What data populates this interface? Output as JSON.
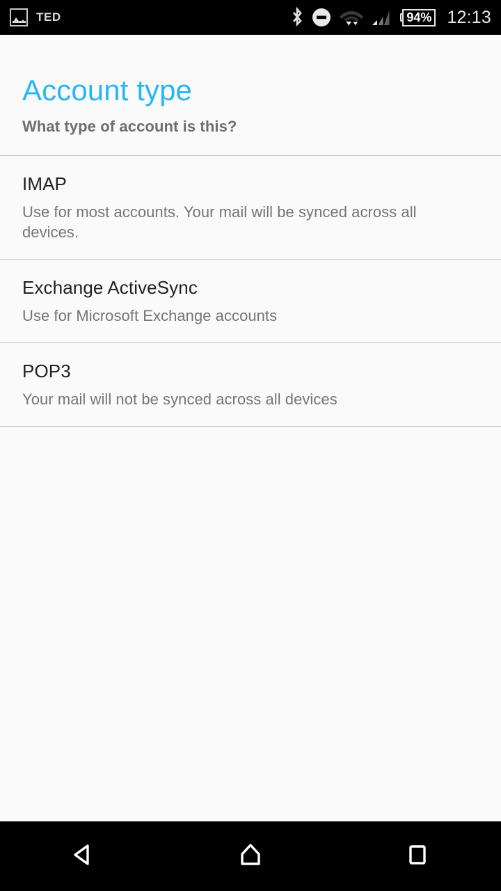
{
  "status_bar": {
    "app_label": "TED",
    "notification_icon": "photo-icon",
    "icons": [
      "bluetooth-icon",
      "do-not-disturb-icon",
      "wifi-icon",
      "cellular-signal-icon"
    ],
    "battery_percent": "94%",
    "clock": "12:13"
  },
  "header": {
    "title": "Account type",
    "subtitle": "What type of account is this?",
    "title_color": "#29b6f6",
    "subtitle_color": "#6e6e6e"
  },
  "list": {
    "items": [
      {
        "title": "IMAP",
        "description": "Use for most accounts. Your mail will be synced across all devices."
      },
      {
        "title": "Exchange ActiveSync",
        "description": "Use for Microsoft Exchange accounts"
      },
      {
        "title": "POP3",
        "description": "Your mail will not be synced across all devices"
      }
    ]
  },
  "nav_bar": {
    "back": "back-icon",
    "home": "home-icon",
    "recents": "recents-icon"
  }
}
